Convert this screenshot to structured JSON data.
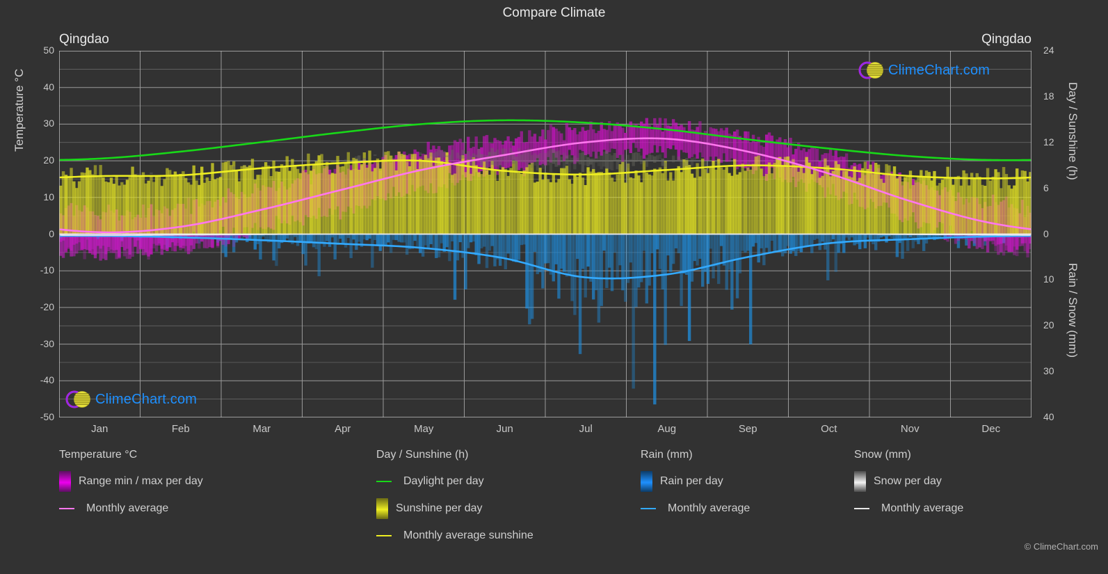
{
  "header": {
    "title": "Compare Climate",
    "city_left": "Qingdao",
    "city_right": "Qingdao"
  },
  "branding": {
    "logo_text": "ClimeChart.com",
    "copyright": "© ClimeChart.com",
    "logo_ring_color": "#cc22cc",
    "logo_ball_color": "#e8e23a",
    "logo_text_color": "#1e90ff"
  },
  "axes": {
    "left_label": "Temperature °C",
    "right_label_top": "Day / Sunshine (h)",
    "right_label_bottom": "Rain / Snow (mm)",
    "left_ticks": [
      "50",
      "40",
      "30",
      "20",
      "10",
      "0",
      "-10",
      "-20",
      "-30",
      "-40",
      "-50"
    ],
    "right_top_ticks": [
      "24",
      "18",
      "12",
      "6",
      "0"
    ],
    "right_bottom_ticks": [
      "0",
      "10",
      "20",
      "30",
      "40"
    ],
    "x_ticks": [
      "Jan",
      "Feb",
      "Mar",
      "Apr",
      "May",
      "Jun",
      "Jul",
      "Aug",
      "Sep",
      "Oct",
      "Nov",
      "Dec"
    ]
  },
  "legend": {
    "groups": [
      {
        "title": "Temperature °C",
        "items": [
          {
            "label": "Range min / max per day",
            "marker": "swatch",
            "color": "#ee00ee",
            "color2": "#5a1060"
          },
          {
            "label": "Monthly average",
            "marker": "line",
            "color": "#ff77ee"
          }
        ]
      },
      {
        "title": "Day / Sunshine (h)",
        "items": [
          {
            "label": "Daylight per day",
            "marker": "line",
            "color": "#18d818"
          },
          {
            "label": "Sunshine per day",
            "marker": "swatch",
            "color": "#eeee22",
            "color2": "#6a6a14"
          },
          {
            "label": "Monthly average sunshine",
            "marker": "line",
            "color": "#eeee22"
          }
        ]
      },
      {
        "title": "Rain (mm)",
        "items": [
          {
            "label": "Rain per day",
            "marker": "swatch",
            "color": "#1e90ff",
            "color2": "#0d3b66"
          },
          {
            "label": "Monthly average",
            "marker": "line",
            "color": "#33aaff"
          }
        ]
      },
      {
        "title": "Snow (mm)",
        "items": [
          {
            "label": "Snow per day",
            "marker": "swatch",
            "color": "#f2f2f2",
            "color2": "#4a4a4a"
          },
          {
            "label": "Monthly average",
            "marker": "line",
            "color": "#e8e8e8"
          }
        ]
      }
    ]
  },
  "chart_data": {
    "type": "area",
    "title": "Compare Climate",
    "subtitle": "Qingdao",
    "xlabel": "",
    "ylabel": "Temperature °C",
    "categories": [
      "Jan",
      "Feb",
      "Mar",
      "Apr",
      "May",
      "Jun",
      "Jul",
      "Aug",
      "Sep",
      "Oct",
      "Nov",
      "Dec"
    ],
    "axis_left": {
      "label": "Temperature °C",
      "min": -50,
      "max": 50,
      "step": 10,
      "unit": "°C"
    },
    "axis_right_top": {
      "label": "Day / Sunshine (h)",
      "min": 0,
      "max": 24,
      "step": 6,
      "unit": "h",
      "maps_to_temp": [
        0,
        50
      ]
    },
    "axis_right_bottom": {
      "label": "Rain / Snow (mm)",
      "min": 0,
      "max": 40,
      "step": 10,
      "unit": "mm",
      "maps_to_temp": [
        0,
        -50
      ]
    },
    "grid": true,
    "legend_position": "bottom",
    "series": [
      {
        "name": "Monthly average temperature",
        "unit": "°C",
        "axis": "left",
        "color": "#ff77ee",
        "values": [
          0.5,
          2.0,
          6.5,
          12.0,
          17.5,
          21.5,
          25.0,
          26.0,
          22.5,
          16.5,
          9.0,
          3.0
        ]
      },
      {
        "name": "Daily max temperature (range top)",
        "unit": "°C",
        "axis": "left",
        "color": "#ee00ee",
        "values": [
          5.5,
          7.0,
          11.5,
          17.0,
          22.0,
          25.5,
          28.5,
          29.5,
          26.5,
          21.0,
          14.0,
          8.0
        ]
      },
      {
        "name": "Daily min temperature (range bottom)",
        "unit": "°C",
        "axis": "left",
        "color": "#8a1d8a",
        "values": [
          -3.5,
          -2.0,
          2.0,
          7.5,
          13.0,
          18.0,
          22.0,
          23.0,
          18.5,
          12.0,
          4.5,
          -1.5
        ]
      },
      {
        "name": "Daylight per day",
        "unit": "h",
        "axis": "right_top",
        "color": "#18d818",
        "values": [
          9.9,
          10.8,
          12.0,
          13.3,
          14.4,
          14.9,
          14.6,
          13.7,
          12.4,
          11.2,
          10.2,
          9.7
        ]
      },
      {
        "name": "Monthly average sunshine",
        "unit": "h",
        "axis": "right_top",
        "color": "#eeee22",
        "values": [
          7.6,
          7.7,
          8.6,
          9.3,
          9.6,
          8.3,
          7.8,
          8.4,
          9.0,
          8.6,
          7.6,
          7.3
        ]
      },
      {
        "name": "Rain monthly average",
        "unit": "mm",
        "axis": "right_bottom",
        "color": "#33aaff",
        "values": [
          0.4,
          0.7,
          1.3,
          2.1,
          3.0,
          5.2,
          9.4,
          8.8,
          5.0,
          2.0,
          1.1,
          0.5
        ]
      },
      {
        "name": "Snow monthly average",
        "unit": "mm",
        "axis": "right_bottom",
        "color": "#e8e8e8",
        "values": [
          0.3,
          0.2,
          0.1,
          0.0,
          0.0,
          0.0,
          0.0,
          0.0,
          0.0,
          0.0,
          0.1,
          0.2
        ]
      }
    ],
    "notes": "Daily bands (min/max temperature magenta, sunshine yellow, rain blue, snow grey) are drawn as per-day vertical strokes behind the smoothed monthly-average curves."
  }
}
